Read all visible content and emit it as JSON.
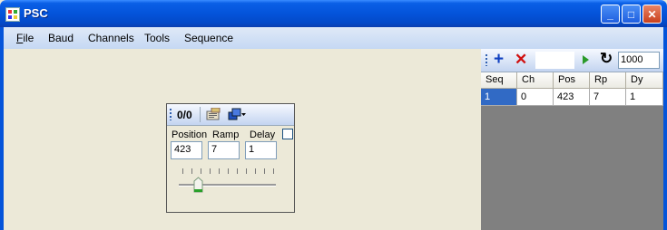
{
  "window": {
    "title": "PSC"
  },
  "menu": {
    "file": "File",
    "file_first": "F",
    "file_rest": "ile",
    "baud": "Baud",
    "channels": "Channels",
    "tools": "Tools",
    "sequence": "Sequence"
  },
  "servo_panel": {
    "counter": "0/0",
    "position_label": "Position",
    "ramp_label": "Ramp",
    "delay_label": "Delay",
    "position_value": "423",
    "ramp_value": "7",
    "delay_value": "1",
    "delay_checked": false,
    "slider_level": 0.2
  },
  "sequence_panel": {
    "interval_value": "1000",
    "columns": [
      "Seq",
      "Ch",
      "Pos",
      "Rp",
      "Dy"
    ],
    "rows": [
      [
        "1",
        "0",
        "423",
        "7",
        "1"
      ]
    ]
  },
  "icons": [
    "app-icon",
    "minimize-icon",
    "maximize-icon",
    "close-icon",
    "config-icon",
    "stack-dropdown-icon",
    "add-icon",
    "delete-icon",
    "play-icon",
    "loop-icon"
  ],
  "colors": {
    "titlebar": "#0454DA",
    "selected_cell": "#316AC5",
    "sequence_background": "#808080",
    "add_icon": "#1040C0",
    "delete_icon": "#D01010",
    "play_icon": "#2A9A2A"
  }
}
